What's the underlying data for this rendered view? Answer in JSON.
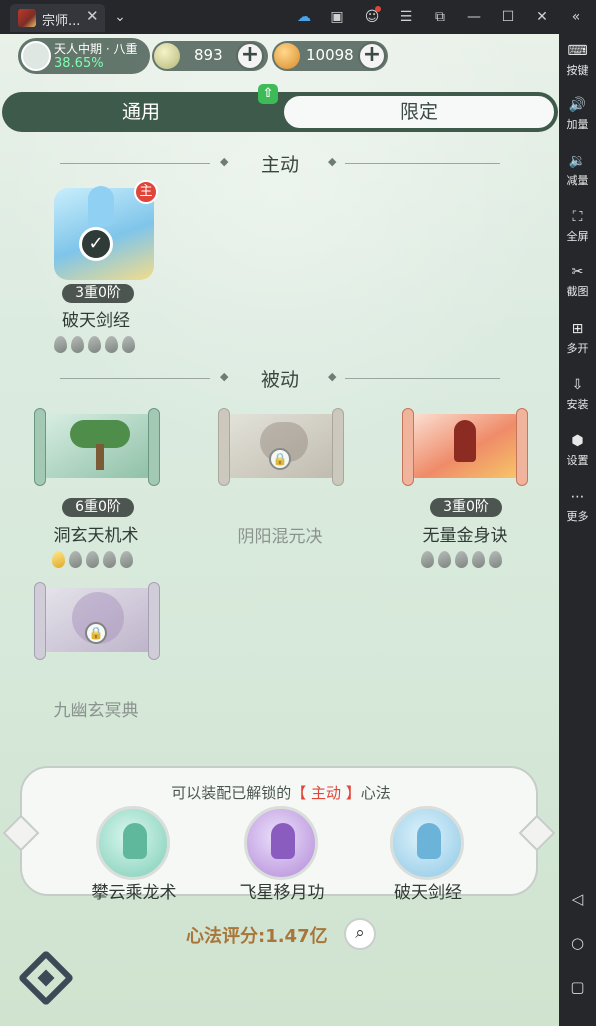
{
  "window": {
    "tab_title": "宗师...",
    "tab_close": "✕",
    "dropdown": "⌄",
    "icons": [
      "cloud-icon",
      "gift-icon",
      "user-icon",
      "menu-icon",
      "external-window-icon",
      "minimize-icon",
      "maximize-icon",
      "close-icon",
      "collapse-icon"
    ]
  },
  "sidebar": {
    "items": [
      {
        "label": "按键",
        "icon": "keyboard-icon"
      },
      {
        "label": "加量",
        "icon": "volume-up-icon"
      },
      {
        "label": "减量",
        "icon": "volume-down-icon"
      },
      {
        "label": "全屏",
        "icon": "fullscreen-icon"
      },
      {
        "label": "截图",
        "icon": "scissors-icon"
      },
      {
        "label": "多开",
        "icon": "multi-open-icon"
      },
      {
        "label": "安装",
        "icon": "apk-install-icon"
      },
      {
        "label": "设置",
        "icon": "settings-icon"
      },
      {
        "label": "更多",
        "icon": "more-icon"
      }
    ],
    "nav": [
      "back-icon",
      "home-icon",
      "recent-icon"
    ]
  },
  "player": {
    "realm": "天人中期 · 八重",
    "progress": "38.65%",
    "progress_fraction": 0.3865
  },
  "currency": {
    "spirit": "893",
    "gold": "10098",
    "plus": "+"
  },
  "tabs": {
    "general": "通用",
    "limited": "限定",
    "active": "general"
  },
  "sections": {
    "active": "主动",
    "passive": "被动"
  },
  "active_skills": [
    {
      "level": "3重0阶",
      "name": "破天剑经",
      "badge": "主",
      "drops_filled": 0,
      "drops_total": 5
    }
  ],
  "passive_skills": [
    {
      "level": "6重0阶",
      "name": "洞玄天机术",
      "locked": false,
      "drops_filled": 1,
      "drops_total": 5
    },
    {
      "level": "",
      "name": "阴阳混元决",
      "locked": true
    },
    {
      "level": "3重0阶",
      "name": "无量金身诀",
      "locked": false,
      "drops_filled": 0,
      "drops_total": 5
    },
    {
      "level": "",
      "name": "九幽玄冥典",
      "locked": true
    }
  ],
  "equip_panel": {
    "hint_pre": "可以装配已解锁的",
    "hint_key": "【 主动 】",
    "hint_post": "心法",
    "skills": [
      "攀云乘龙术",
      "飞星移月功",
      "破天剑经"
    ]
  },
  "score": {
    "label": "心法评分:1.47亿"
  },
  "colors": {
    "accent_red": "#e0453a",
    "tab_dark": "#3e5a4b",
    "score_brown": "#a8763a"
  }
}
